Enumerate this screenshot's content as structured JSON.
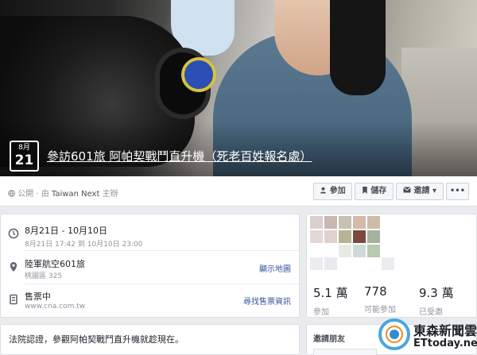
{
  "event": {
    "month": "8月",
    "day": "21",
    "title": "參訪601旅 阿帕契戰鬥直升機（死老百姓報名處）"
  },
  "bar": {
    "privacy": "公開",
    "host_prefix": "由",
    "host": "Taiwan Next",
    "host_suffix": "主辦",
    "buttons": {
      "join": "參加",
      "save": "儲存",
      "invite": "邀請",
      "more": "•••"
    }
  },
  "info": {
    "date": {
      "title": "8月21日 - 10月10日",
      "sub": "8月21日 17:42 到 10月10日 23:00"
    },
    "location": {
      "title": "陸軍航空601旅",
      "sub": "桃園區 325",
      "link": "顯示地圖"
    },
    "tickets": {
      "title": "售票中",
      "sub": "www.cna.com.tw",
      "link": "尋找售票資訊"
    }
  },
  "stats": [
    {
      "value": "5.1 萬",
      "label": "參加"
    },
    {
      "value": "778",
      "label": "可能參加"
    },
    {
      "value": "9.3 萬",
      "label": "已受邀"
    }
  ],
  "post": {
    "text": "法院認證，參觀阿帕契戰鬥直升機就趁現在。"
  },
  "invite": {
    "title": "邀請朋友"
  },
  "watermark": {
    "line1": "東森新聞雲",
    "line2": "ETtoday.net"
  }
}
